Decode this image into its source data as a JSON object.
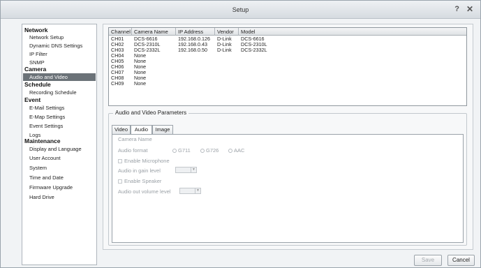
{
  "window": {
    "title": "Setup"
  },
  "sidebar": {
    "items": [
      {
        "label": "Network",
        "type": "category"
      },
      {
        "label": "Network Setup",
        "type": "sub"
      },
      {
        "label": "Dynamic DNS Settings",
        "type": "sub"
      },
      {
        "label": "IP Filter",
        "type": "sub"
      },
      {
        "label": "SNMP",
        "type": "sub"
      },
      {
        "label": "Camera",
        "type": "category"
      },
      {
        "label": "Audio and Video",
        "type": "sub",
        "selected": true
      },
      {
        "label": "Schedule",
        "type": "category"
      },
      {
        "label": "Recording Schedule",
        "type": "sub"
      },
      {
        "label": "Event",
        "type": "category"
      },
      {
        "label": "E-Mail Settings",
        "type": "sub"
      },
      {
        "label": "E-Map Settings",
        "type": "sub"
      },
      {
        "label": "Event Settings",
        "type": "sub"
      },
      {
        "label": "Logs",
        "type": "sub"
      },
      {
        "label": "Maintenance",
        "type": "category"
      },
      {
        "label": "Display and Language",
        "type": "sub"
      },
      {
        "label": "User Account",
        "type": "sub"
      },
      {
        "label": "System",
        "type": "sub"
      },
      {
        "label": "Time and Date",
        "type": "sub"
      },
      {
        "label": "Firmware Upgrade",
        "type": "sub"
      },
      {
        "label": "Hard Drive",
        "type": "sub"
      }
    ]
  },
  "channels": {
    "columns": [
      "Channel",
      "Camera Name",
      "IP Address",
      "Vendor",
      "Model"
    ],
    "rows": [
      [
        "CH01",
        "DCS-6616",
        "192.168.0.126",
        "D-Link",
        "DCS-6616"
      ],
      [
        "CH02",
        "DCS-2310L",
        "192.168.0.43",
        "D-Link",
        "DCS-2310L"
      ],
      [
        "CH03",
        "DCS-2332L",
        "192.168.0.50",
        "D-Link",
        "DCS-2332L"
      ],
      [
        "CH04",
        "None",
        "",
        "",
        ""
      ],
      [
        "CH05",
        "None",
        "",
        "",
        ""
      ],
      [
        "CH06",
        "None",
        "",
        "",
        ""
      ],
      [
        "CH07",
        "None",
        "",
        "",
        ""
      ],
      [
        "CH08",
        "None",
        "",
        "",
        ""
      ],
      [
        "CH09",
        "None",
        "",
        "",
        ""
      ]
    ]
  },
  "av_params": {
    "legend": "Audio and Video Parameters",
    "tabs": [
      "Video",
      "Audio",
      "Image"
    ],
    "active_tab": "Audio",
    "camera_name_label": "Camera Name",
    "audio_format_label": "Audio format",
    "audio_format_options": [
      "G711",
      "G726",
      "AAC"
    ],
    "enable_microphone_label": "Enable Microphone",
    "audio_in_gain_label": "Audio in gain level",
    "enable_speaker_label": "Enable Speaker",
    "audio_out_volume_label": "Audio out volume level"
  },
  "footer": {
    "save_label": "Save",
    "cancel_label": "Cancel"
  },
  "icons": {
    "help": "help-icon",
    "close": "close-icon",
    "dropdown": "chevron-down-icon"
  },
  "colors": {
    "selected_bg": "#6b7278",
    "selected_text": "#ffffff",
    "titlebar": "#dde1e5"
  }
}
